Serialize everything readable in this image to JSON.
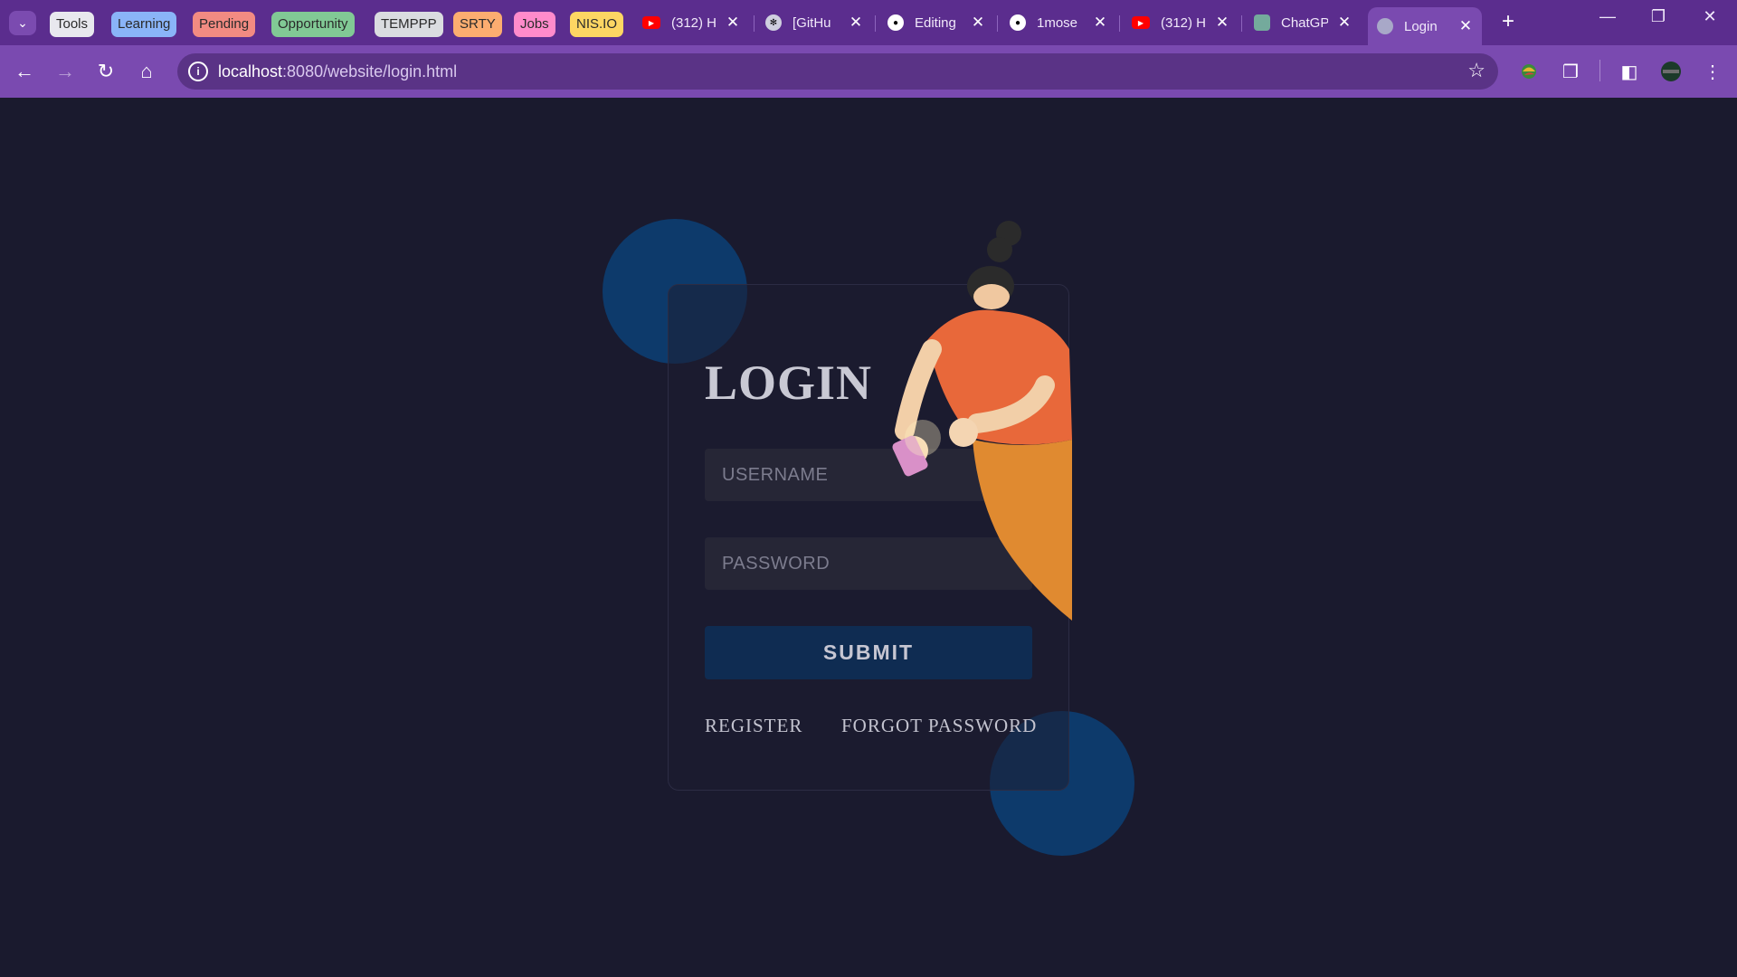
{
  "browser": {
    "tab_groups": [
      {
        "label": "Tools",
        "color": "#e8e8ee"
      },
      {
        "label": "Learning",
        "color": "#8ab4f8"
      },
      {
        "label": "Pending",
        "color": "#f28b82"
      },
      {
        "label": "Opportunity",
        "color": "#81c995"
      },
      {
        "label": "TEMPPP",
        "color": "#dadce0"
      },
      {
        "label": "SRTY",
        "color": "#fcad70"
      },
      {
        "label": "Jobs",
        "color": "#ff8bcb"
      },
      {
        "label": "NIS.IO",
        "color": "#fdd663"
      }
    ],
    "tabs": [
      {
        "title": "(312) H",
        "icon": "youtube-icon"
      },
      {
        "title": "[GitHu",
        "icon": "openai-icon"
      },
      {
        "title": "Editing",
        "icon": "github-icon"
      },
      {
        "title": "1mose",
        "icon": "github-icon"
      },
      {
        "title": "(312) H",
        "icon": "youtube-icon"
      },
      {
        "title": "ChatGP",
        "icon": "chatgpt-icon"
      },
      {
        "title": "Login",
        "icon": "globe-icon",
        "active": true
      }
    ],
    "address_bar": {
      "host": "localhost",
      "rest": ":8080/website/login.html"
    },
    "theme_color": "#5b2d8e"
  },
  "login": {
    "title": "LOGIN",
    "username_placeholder": "USERNAME",
    "password_placeholder": "PASSWORD",
    "submit_label": "SUBMIT",
    "register_label": "REGISTER",
    "forgot_label": "FORGOT PASSWORD"
  },
  "colors": {
    "page_bg": "#1a1a2e",
    "blob": "#0d3a6b",
    "submit_bg": "#0f2c52"
  }
}
